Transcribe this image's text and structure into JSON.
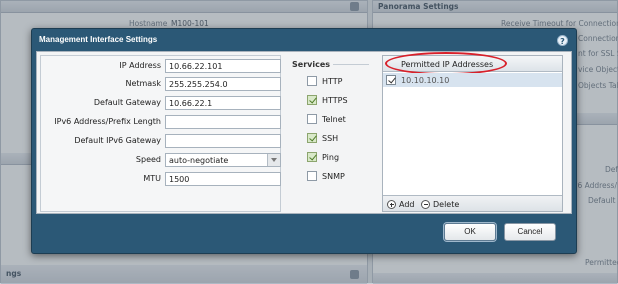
{
  "background": {
    "left_header_text": "",
    "left_hostname_label": "Hostname",
    "left_hostname_value": "M100-101",
    "right_header_text": "Panorama Settings",
    "right_lines": [
      "Receive Timeout for Connection to",
      "Connection to",
      "nt for SSL S",
      "vice Objects",
      "Objects Tak",
      "Def",
      "v6 Address/",
      "Default I",
      "Permitted"
    ],
    "bottom_left_header": "ngs"
  },
  "dialog": {
    "title": "Management Interface Settings",
    "help": "?"
  },
  "form": {
    "ip_address": {
      "label": "IP Address",
      "value": "10.66.22.101"
    },
    "netmask": {
      "label": "Netmask",
      "value": "255.255.254.0"
    },
    "default_gateway": {
      "label": "Default Gateway",
      "value": "10.66.22.1"
    },
    "ipv6_address": {
      "label": "IPv6 Address/Prefix Length",
      "value": ""
    },
    "ipv6_gateway": {
      "label": "Default IPv6 Gateway",
      "value": ""
    },
    "speed": {
      "label": "Speed",
      "value": "auto-negotiate"
    },
    "mtu": {
      "label": "MTU",
      "value": "1500"
    }
  },
  "services": {
    "title": "Services",
    "items": [
      {
        "label": "HTTP",
        "checked": false
      },
      {
        "label": "HTTPS",
        "checked": true
      },
      {
        "label": "Telnet",
        "checked": false
      },
      {
        "label": "SSH",
        "checked": true
      },
      {
        "label": "Ping",
        "checked": true
      },
      {
        "label": "SNMP",
        "checked": false
      }
    ]
  },
  "permitted_ips": {
    "header": "Permitted IP Addresses",
    "rows": [
      {
        "value": "10.10.10.10",
        "checked": true
      }
    ],
    "add_label": "Add",
    "delete_label": "Delete",
    "highlight_color": "#d8202a"
  },
  "footer": {
    "ok_label": "OK",
    "cancel_label": "Cancel"
  }
}
